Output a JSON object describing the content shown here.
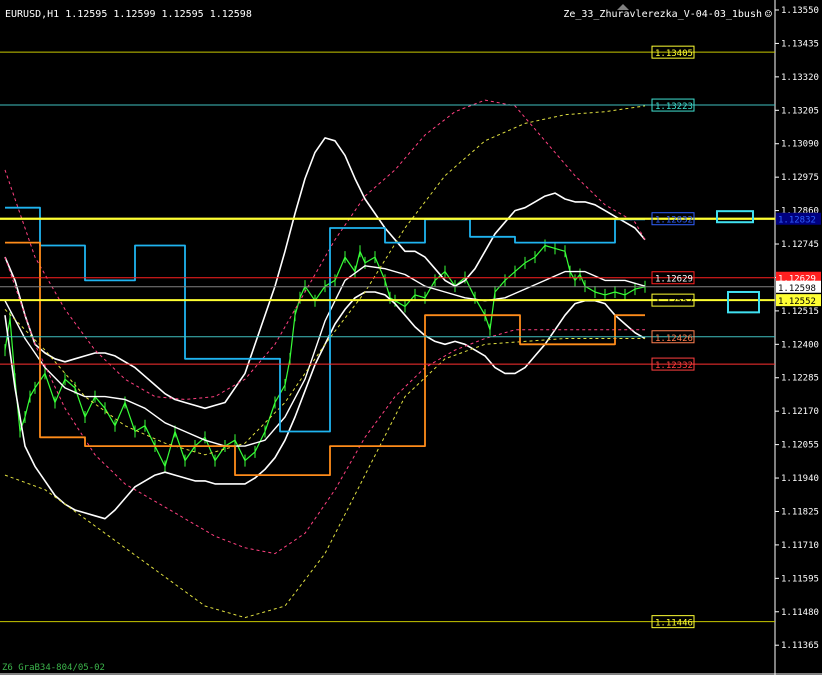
{
  "header": {
    "symbol_info": "EURUSD,H1  1.12595 1.12599 1.12595 1.12598",
    "indicator_name": "Ze_33_Zhuravlerezka_V-04-03_1bush",
    "smiley": "☺"
  },
  "footer": {
    "text": "Z6 GraB34-804/05-02"
  },
  "colors": {
    "background": "#000000",
    "candle": "#38ff38",
    "bands": "#ffffff",
    "cyan_steps": "#1fb4f0",
    "orange_steps": "#ff8c1a",
    "yellow": "#ffff33"
  },
  "chart_data": {
    "type": "line",
    "ylim": [
      1.1129,
      1.1355
    ],
    "y_ticks": [
      "1.13550",
      "1.13435",
      "1.13320",
      "1.13205",
      "1.13090",
      "1.12975",
      "1.12860",
      "1.12745",
      "1.12630",
      "1.12515",
      "1.12400",
      "1.12285",
      "1.12170",
      "1.12055",
      "1.11940",
      "1.11825",
      "1.11710",
      "1.11595",
      "1.11480",
      "1.11365"
    ],
    "current_price": "1.12598",
    "price_labels": [
      {
        "text": "1.13405",
        "value": 1.13405,
        "color": "#ffff33",
        "line": "#c8c800",
        "box": "#ffff33",
        "width": 1
      },
      {
        "text": "1.13223",
        "value": 1.13223,
        "color": "#40e0d0",
        "line": "#40c0c0",
        "box": "#40e0d0",
        "width": 1
      },
      {
        "text": "1.12832",
        "value": 1.12832,
        "color": "#3060ff",
        "line": "#ffff33",
        "box": "#3060ff",
        "width": 2.2,
        "bg": "#000080"
      },
      {
        "text": "1.12629",
        "value": 1.12629,
        "color": "#ffffff",
        "line": "#ff2020",
        "box": "#ff2020",
        "width": 1,
        "bg": "#ff2020"
      },
      {
        "text": "1.12552",
        "value": 1.12552,
        "color": "#000000",
        "line": "#ffff33",
        "box": "#ffff33",
        "width": 2,
        "bg": "#ffff33"
      },
      {
        "text": "1.12426",
        "value": 1.12426,
        "color": "#ff7f50",
        "line": "#40c0c0",
        "box": "#ff7f50",
        "width": 1
      },
      {
        "text": "1.12332",
        "value": 1.12332,
        "color": "#ff4040",
        "line": "#ff3030",
        "box": "#ff4040",
        "width": 1
      },
      {
        "text": "1.11446",
        "value": 1.11446,
        "color": "#ffff33",
        "line": "#c8c800",
        "box": "#ffff33",
        "width": 1
      }
    ],
    "series": [
      {
        "style": "close",
        "color": "#38ff38",
        "width": 1.2,
        "x": [
          0,
          5,
          10,
          15,
          20,
          25,
          30,
          40,
          50,
          60,
          70,
          80,
          90,
          100,
          110,
          120,
          130,
          140,
          150,
          160,
          170,
          180,
          190,
          200,
          210,
          220,
          230,
          240,
          250,
          260,
          270,
          280,
          285,
          290,
          295,
          300,
          310,
          320,
          330,
          340,
          350,
          355,
          360,
          370,
          380,
          385,
          390,
          400,
          410,
          420,
          430,
          440,
          450,
          460,
          470,
          480,
          485,
          490,
          500,
          510,
          520,
          530,
          540,
          550,
          560,
          565,
          570,
          575,
          580,
          590,
          600,
          610,
          620,
          630,
          640
        ],
        "y": [
          1.1238,
          1.1249,
          1.1228,
          1.121,
          1.1215,
          1.1222,
          1.1225,
          1.123,
          1.122,
          1.1228,
          1.1225,
          1.1215,
          1.1222,
          1.1218,
          1.1212,
          1.122,
          1.121,
          1.1212,
          1.1205,
          1.1198,
          1.121,
          1.12,
          1.1205,
          1.1208,
          1.12,
          1.1205,
          1.1207,
          1.12,
          1.1203,
          1.121,
          1.122,
          1.1226,
          1.1235,
          1.125,
          1.1256,
          1.126,
          1.1255,
          1.126,
          1.1262,
          1.127,
          1.1265,
          1.1272,
          1.1268,
          1.127,
          1.1262,
          1.1256,
          1.1255,
          1.1253,
          1.1257,
          1.1256,
          1.1262,
          1.1265,
          1.126,
          1.1263,
          1.1256,
          1.125,
          1.1245,
          1.1258,
          1.1262,
          1.1265,
          1.1268,
          1.127,
          1.1274,
          1.1273,
          1.1272,
          1.1265,
          1.1262,
          1.1264,
          1.126,
          1.1258,
          1.1257,
          1.1258,
          1.1257,
          1.1259,
          1.12598
        ]
      },
      {
        "style": "band",
        "color": "#ffffff",
        "width": 1.6,
        "x": [
          0,
          10,
          20,
          30,
          40,
          50,
          60,
          70,
          80,
          90,
          100,
          110,
          120,
          130,
          140,
          150,
          160,
          170,
          180,
          190,
          200,
          210,
          220,
          230,
          240,
          250,
          260,
          270,
          280,
          290,
          300,
          310,
          320,
          330,
          340,
          350,
          360,
          370,
          380,
          390,
          400,
          410,
          420,
          430,
          440,
          450,
          460,
          470,
          480,
          490,
          500,
          510,
          520,
          530,
          540,
          550,
          560,
          570,
          580,
          590,
          600,
          610,
          620,
          630,
          640
        ],
        "y": [
          1.127,
          1.1262,
          1.125,
          1.124,
          1.1237,
          1.1235,
          1.1234,
          1.1235,
          1.1236,
          1.1237,
          1.1237,
          1.1236,
          1.1234,
          1.1232,
          1.1229,
          1.1226,
          1.1223,
          1.1221,
          1.122,
          1.1219,
          1.1218,
          1.1219,
          1.122,
          1.1225,
          1.123,
          1.124,
          1.125,
          1.126,
          1.1272,
          1.1285,
          1.1297,
          1.1306,
          1.1311,
          1.131,
          1.1305,
          1.1297,
          1.129,
          1.1285,
          1.128,
          1.1276,
          1.1272,
          1.1272,
          1.127,
          1.1266,
          1.1262,
          1.126,
          1.1262,
          1.1266,
          1.1272,
          1.1278,
          1.1282,
          1.1286,
          1.1287,
          1.1289,
          1.1291,
          1.1292,
          1.129,
          1.1289,
          1.1289,
          1.1288,
          1.1286,
          1.1284,
          1.1282,
          1.128,
          1.1276
        ]
      },
      {
        "style": "band",
        "color": "#ffffff",
        "width": 1.6,
        "x": [
          0,
          10,
          20,
          30,
          40,
          50,
          60,
          70,
          80,
          90,
          100,
          110,
          120,
          130,
          140,
          150,
          160,
          170,
          180,
          190,
          200,
          210,
          220,
          230,
          240,
          250,
          260,
          270,
          280,
          290,
          300,
          310,
          320,
          330,
          340,
          350,
          360,
          370,
          380,
          390,
          400,
          410,
          420,
          430,
          440,
          450,
          460,
          470,
          480,
          490,
          500,
          510,
          520,
          530,
          540,
          550,
          560,
          570,
          580,
          590,
          600,
          610,
          620,
          630,
          640
        ],
        "y": [
          1.125,
          1.1225,
          1.1205,
          1.1198,
          1.1193,
          1.1188,
          1.1185,
          1.1183,
          1.1182,
          1.1181,
          1.118,
          1.1183,
          1.1187,
          1.1191,
          1.1193,
          1.1195,
          1.1196,
          1.1195,
          1.1194,
          1.1193,
          1.1193,
          1.1192,
          1.1192,
          1.1192,
          1.1192,
          1.1194,
          1.1197,
          1.1201,
          1.1207,
          1.1215,
          1.1224,
          1.1233,
          1.124,
          1.1247,
          1.1252,
          1.1256,
          1.1258,
          1.1258,
          1.1257,
          1.1254,
          1.125,
          1.1246,
          1.1243,
          1.1241,
          1.124,
          1.1241,
          1.124,
          1.1238,
          1.1236,
          1.1232,
          1.123,
          1.123,
          1.1232,
          1.1236,
          1.124,
          1.1245,
          1.125,
          1.1254,
          1.1255,
          1.1255,
          1.1254,
          1.125,
          1.1247,
          1.1244,
          1.1242
        ]
      },
      {
        "style": "band",
        "color": "#ffffff",
        "width": 1.4,
        "x": [
          0,
          20,
          40,
          60,
          80,
          100,
          120,
          140,
          160,
          180,
          200,
          220,
          240,
          260,
          280,
          300,
          320,
          340,
          360,
          380,
          400,
          420,
          440,
          460,
          480,
          500,
          520,
          540,
          560,
          580,
          600,
          620,
          640
        ],
        "y": [
          1.1255,
          1.1242,
          1.1232,
          1.1225,
          1.1222,
          1.1222,
          1.1221,
          1.1218,
          1.1213,
          1.121,
          1.1207,
          1.1205,
          1.1205,
          1.1207,
          1.1215,
          1.1228,
          1.1248,
          1.1262,
          1.1267,
          1.1266,
          1.1264,
          1.126,
          1.1258,
          1.1256,
          1.1255,
          1.1256,
          1.1259,
          1.1262,
          1.1265,
          1.1265,
          1.1262,
          1.1262,
          1.126
        ]
      },
      {
        "style": "dash",
        "color": "#ff4080",
        "width": 1,
        "x": [
          0,
          30,
          60,
          90,
          120,
          150,
          180,
          210,
          240,
          270,
          300,
          330,
          360,
          390,
          420,
          450,
          480,
          510,
          540,
          570,
          600,
          630,
          640
        ],
        "y": [
          1.13,
          1.127,
          1.1252,
          1.1238,
          1.1228,
          1.1222,
          1.1221,
          1.1222,
          1.1228,
          1.124,
          1.1258,
          1.1276,
          1.1291,
          1.13,
          1.1312,
          1.132,
          1.1324,
          1.1322,
          1.131,
          1.1298,
          1.1288,
          1.1282,
          1.1276
        ]
      },
      {
        "style": "dash",
        "color": "#ff4080",
        "width": 1,
        "x": [
          0,
          30,
          60,
          90,
          120,
          150,
          180,
          210,
          240,
          270,
          300,
          330,
          360,
          390,
          420,
          450,
          480,
          510,
          540,
          570,
          600,
          630,
          640
        ],
        "y": [
          1.127,
          1.124,
          1.1218,
          1.1202,
          1.1192,
          1.1186,
          1.118,
          1.1174,
          1.117,
          1.1168,
          1.1175,
          1.119,
          1.1208,
          1.1222,
          1.1232,
          1.1238,
          1.1242,
          1.1245,
          1.1245,
          1.1245,
          1.1245,
          1.1245,
          1.1245
        ]
      },
      {
        "style": "dash",
        "color": "#e0e040",
        "width": 1,
        "x": [
          0,
          40,
          80,
          120,
          160,
          200,
          240,
          280,
          320,
          360,
          400,
          440,
          480,
          520,
          560,
          600,
          640
        ],
        "y": [
          1.1195,
          1.119,
          1.118,
          1.117,
          1.116,
          1.115,
          1.1146,
          1.115,
          1.1168,
          1.1195,
          1.1222,
          1.1235,
          1.124,
          1.1241,
          1.1242,
          1.1242,
          1.1242
        ]
      },
      {
        "style": "dash",
        "color": "#e0e040",
        "width": 1,
        "x": [
          0,
          40,
          80,
          120,
          160,
          200,
          240,
          280,
          320,
          360,
          400,
          440,
          480,
          520,
          560,
          600,
          640
        ],
        "y": [
          1.1252,
          1.1238,
          1.1222,
          1.1212,
          1.1206,
          1.1202,
          1.1206,
          1.122,
          1.124,
          1.1258,
          1.128,
          1.1298,
          1.131,
          1.1316,
          1.1319,
          1.132,
          1.1322
        ]
      },
      {
        "style": "step",
        "color": "#1fb4f0",
        "width": 1.8,
        "x": [
          0,
          35,
          35,
          80,
          80,
          130,
          130,
          180,
          180,
          230,
          230,
          275,
          275,
          325,
          325,
          380,
          380,
          420,
          420,
          465,
          465,
          510,
          510,
          565,
          565,
          610,
          610,
          640
        ],
        "y": [
          1.1287,
          1.1287,
          1.1274,
          1.1274,
          1.1262,
          1.1262,
          1.1274,
          1.1274,
          1.1235,
          1.1235,
          1.1235,
          1.1235,
          1.121,
          1.121,
          1.128,
          1.128,
          1.1275,
          1.1275,
          1.1283,
          1.1283,
          1.1277,
          1.1277,
          1.1275,
          1.1275,
          1.1275,
          1.1275,
          1.1283,
          1.1283
        ]
      },
      {
        "style": "step",
        "color": "#ff8c1a",
        "width": 1.8,
        "x": [
          0,
          35,
          35,
          80,
          80,
          130,
          130,
          180,
          180,
          230,
          230,
          275,
          275,
          325,
          325,
          380,
          380,
          420,
          420,
          465,
          465,
          515,
          515,
          565,
          565,
          610,
          610,
          640
        ],
        "y": [
          1.1275,
          1.1275,
          1.1208,
          1.1208,
          1.1205,
          1.1205,
          1.1205,
          1.1205,
          1.1205,
          1.1205,
          1.1195,
          1.1195,
          1.1195,
          1.1195,
          1.1205,
          1.1205,
          1.1205,
          1.1205,
          1.125,
          1.125,
          1.125,
          1.125,
          1.124,
          1.124,
          1.124,
          1.124,
          1.125,
          1.125
        ]
      }
    ],
    "rectangles": [
      {
        "x0": 1.12858,
        "x1": 1.1282,
        "color": "#40e0f0"
      },
      {
        "x0": 1.1258,
        "x1": 1.1251,
        "color": "#40e0f0"
      }
    ]
  }
}
